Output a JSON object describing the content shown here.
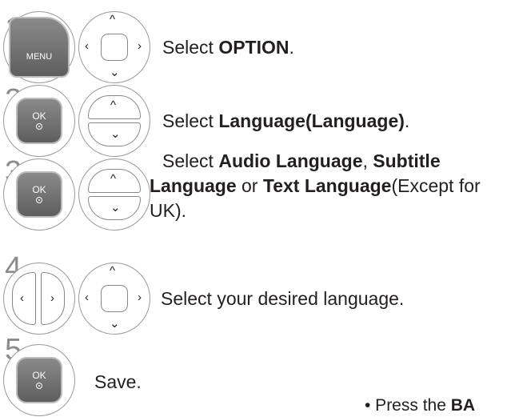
{
  "steps": [
    {
      "number": "1",
      "buttons": [
        "MENU",
        "navigation-pad"
      ],
      "text_parts": [
        {
          "text": "Select ",
          "bold": false
        },
        {
          "text": "OPTION",
          "bold": true
        },
        {
          "text": ".",
          "bold": false
        }
      ]
    },
    {
      "number": "2",
      "buttons": [
        "OK",
        "up-down-keys"
      ],
      "text_parts": [
        {
          "text": "Select ",
          "bold": false
        },
        {
          "text": "Language(Language)",
          "bold": true
        },
        {
          "text": ".",
          "bold": false
        }
      ]
    },
    {
      "number": "3",
      "buttons": [
        "OK",
        "up-down-keys"
      ],
      "text_parts": [
        {
          "text": "Select ",
          "bold": false
        },
        {
          "text": "Audio Language",
          "bold": true
        },
        {
          "text": ", ",
          "bold": false
        },
        {
          "text": "Subtitle Language",
          "bold": true
        },
        {
          "text": " or ",
          "bold": false
        },
        {
          "text": "Text Language",
          "bold": true
        },
        {
          "text": "(Except for UK).",
          "bold": false
        }
      ]
    },
    {
      "number": "4",
      "buttons": [
        "left-right-keys",
        "navigation-pad"
      ],
      "text_parts": [
        {
          "text": "Select your desired language.",
          "bold": false
        }
      ]
    },
    {
      "number": "5",
      "buttons": [
        "OK"
      ],
      "text_parts": [
        {
          "text": "Save.",
          "bold": false
        }
      ]
    }
  ],
  "key_labels": {
    "menu": "MENU",
    "ok": "OK"
  },
  "footer_note": {
    "prefix": "• Press the ",
    "bold": "BA"
  },
  "colors": {
    "step_number": "#8c8c8c",
    "key_fill": "#6e6e6e",
    "ring": "#9a9a9a"
  }
}
